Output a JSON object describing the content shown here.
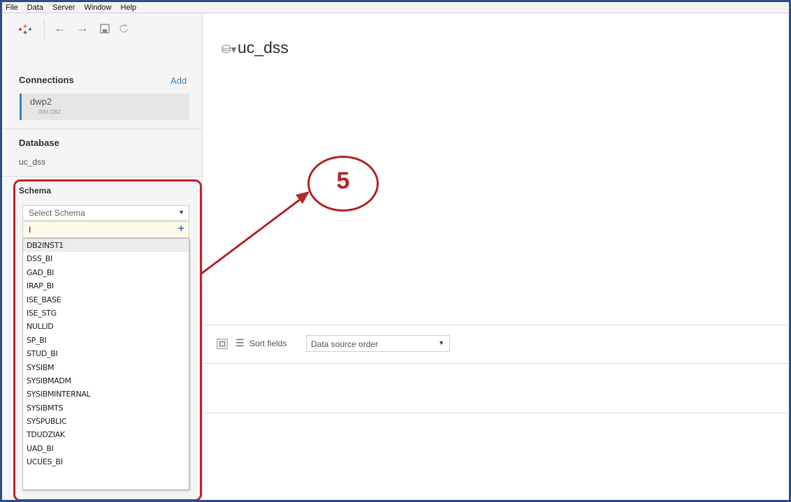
{
  "menu": [
    "File",
    "Data",
    "Server",
    "Window",
    "Help"
  ],
  "toolbar": {
    "logo": "tableau-logo-icon",
    "back": "←",
    "forward": "→",
    "save": "save-icon",
    "refresh": "refresh-icon"
  },
  "connections": {
    "title": "Connections",
    "add_label": "Add",
    "items": [
      {
        "name": "dwp2",
        "type": "IBM DB2"
      }
    ]
  },
  "database": {
    "title": "Database",
    "value": "uc_dss"
  },
  "schema": {
    "title": "Schema",
    "select_placeholder": "Select Schema",
    "search_value": "I",
    "selected_index": 0,
    "options": [
      "DB2INST1",
      "DSS_BI",
      "GAD_BI",
      "IRAP_BI",
      "ISE_BASE",
      "ISE_STG",
      "NULLID",
      "SP_BI",
      "STUD_BI",
      "SYSIBM",
      "SYSIBMADM",
      "SYSIBMINTERNAL",
      "SYSIBMTS",
      "SYSPUBLIC",
      "TDUDZIAK",
      "UAD_BI",
      "UCUES_BI"
    ]
  },
  "main": {
    "title": "uc_dss",
    "sort_label": "Sort fields",
    "sort_value": "Data source order"
  },
  "annotation": {
    "number": "5",
    "color": "#b3262b"
  }
}
